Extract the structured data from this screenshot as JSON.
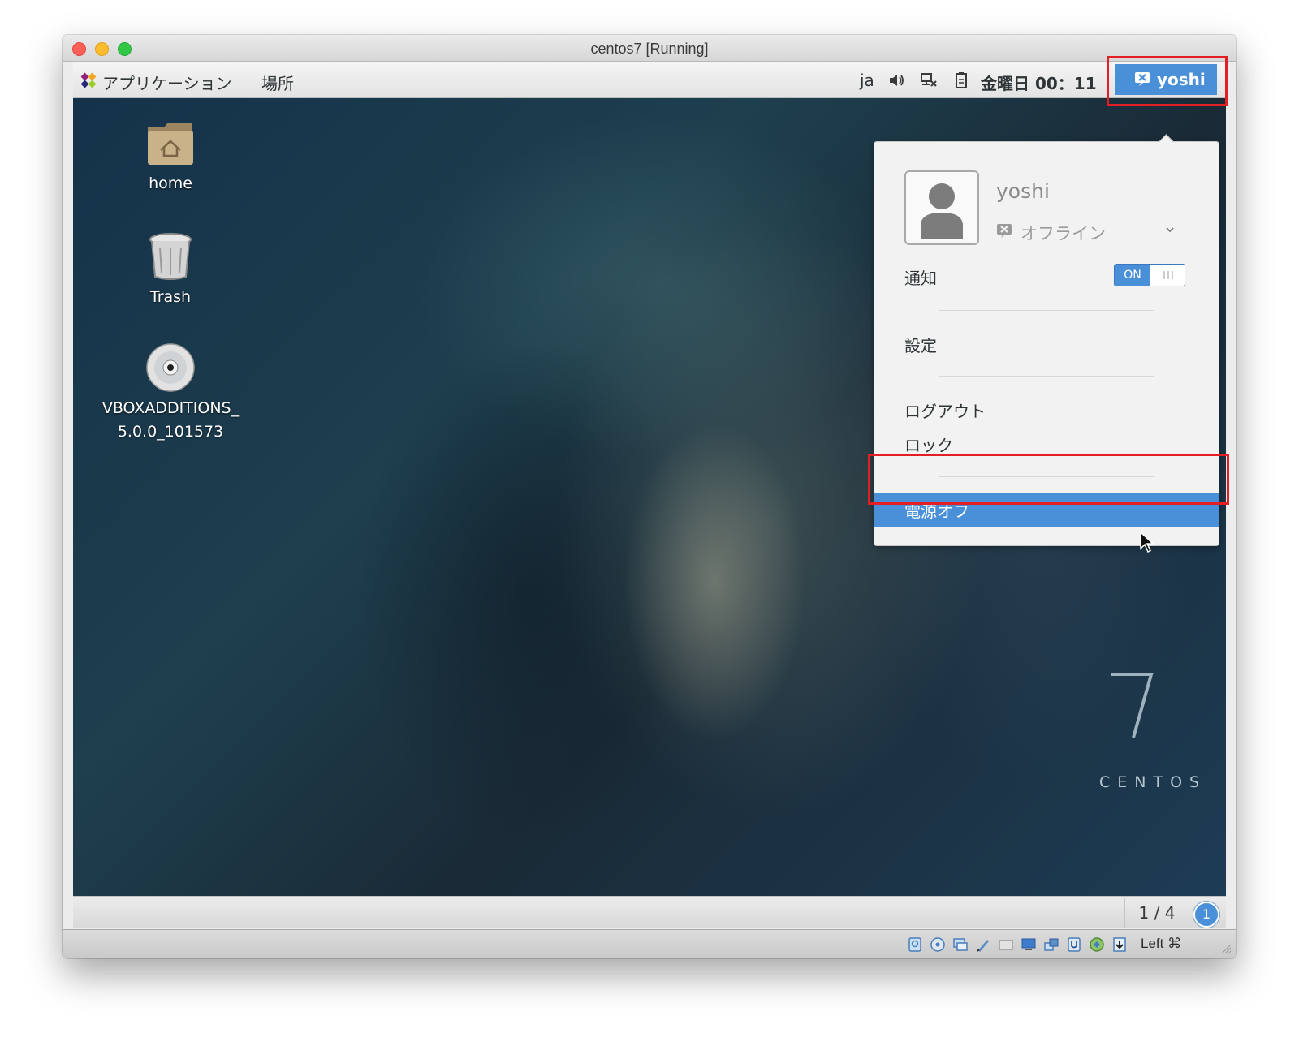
{
  "window": {
    "title": "centos7 [Running]"
  },
  "topbar": {
    "applications": "アプリケーション",
    "places": "場所",
    "input_method": "ja",
    "clock": "金曜日 00：11",
    "user_button": "yoshi",
    "icons": [
      "applications-logo-icon",
      "volume-icon",
      "network-icon",
      "battery-clipboard-icon",
      "user-offline-icon"
    ]
  },
  "desktop": {
    "icons": [
      {
        "label": "home",
        "icon": "home-folder-icon"
      },
      {
        "label": "Trash",
        "icon": "trash-icon"
      },
      {
        "label_line1": "VBOXADDITIONS_",
        "label_line2": "5.0.0_101573",
        "icon": "optical-disc-icon"
      }
    ],
    "watermark": {
      "number": "7",
      "word": "CENTOS"
    }
  },
  "user_menu": {
    "username": "yoshi",
    "status": "オフライン",
    "notifications_label": "通知",
    "notifications_toggle": "ON",
    "notifications_enabled": true,
    "settings": "設定",
    "logout": "ログアウト",
    "lock": "ロック",
    "power_off": "電源オフ"
  },
  "bottom_panel": {
    "workspace": "1 / 4",
    "notification_count": "1"
  },
  "statusbar": {
    "host_key": "Left ⌘",
    "icons": [
      "hard-disk-icon",
      "optical-drive-icon",
      "audio-icon",
      "usb-icon",
      "shared-folders-icon",
      "display-icon",
      "network-adapter-icon",
      "video-capture-icon",
      "cpu-icon",
      "mouse-integration-icon",
      "keyboard-capture-icon"
    ]
  },
  "colors": {
    "accent": "#4a90d9",
    "highlight_box": "#e31e24",
    "panel": "#e8e8e8"
  }
}
